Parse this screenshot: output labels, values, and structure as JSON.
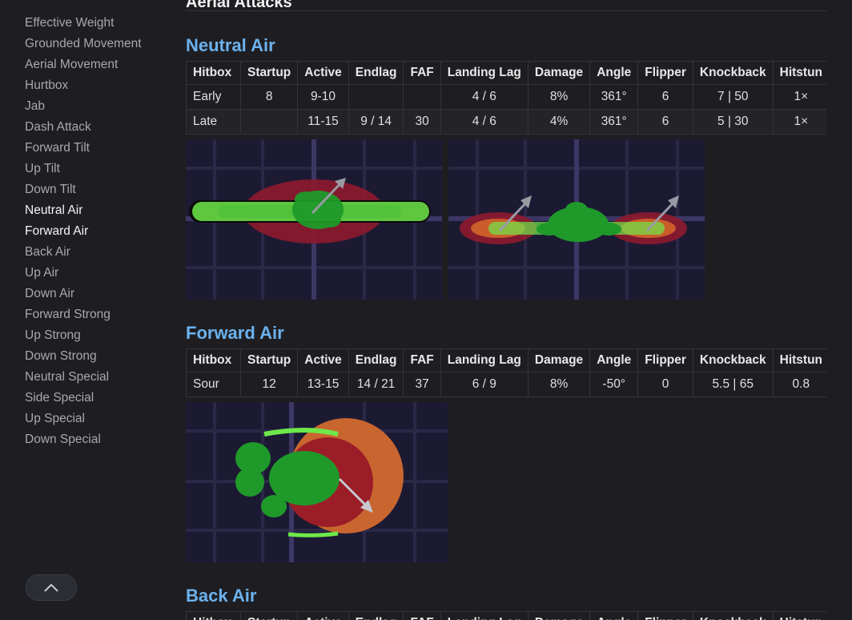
{
  "sidebar": {
    "items": [
      {
        "label": "Effective Weight",
        "active": false
      },
      {
        "label": "Grounded Movement",
        "active": false
      },
      {
        "label": "Aerial Movement",
        "active": false
      },
      {
        "label": "Hurtbox",
        "active": false
      },
      {
        "label": "Jab",
        "active": false
      },
      {
        "label": "Dash Attack",
        "active": false
      },
      {
        "label": "Forward Tilt",
        "active": false
      },
      {
        "label": "Up Tilt",
        "active": false
      },
      {
        "label": "Down Tilt",
        "active": false
      },
      {
        "label": "Neutral Air",
        "active": true
      },
      {
        "label": "Forward Air",
        "active": true
      },
      {
        "label": "Back Air",
        "active": false
      },
      {
        "label": "Up Air",
        "active": false
      },
      {
        "label": "Down Air",
        "active": false
      },
      {
        "label": "Forward Strong",
        "active": false
      },
      {
        "label": "Up Strong",
        "active": false
      },
      {
        "label": "Down Strong",
        "active": false
      },
      {
        "label": "Neutral Special",
        "active": false
      },
      {
        "label": "Side Special",
        "active": false
      },
      {
        "label": "Up Special",
        "active": false
      },
      {
        "label": "Down Special",
        "active": false
      }
    ],
    "back_to_top_icon": "chevron-up-icon"
  },
  "page": {
    "section_header": "Aerial Attacks"
  },
  "columns": [
    "Hitbox",
    "Startup",
    "Active",
    "Endlag",
    "FAF",
    "Landing Lag",
    "Damage",
    "Angle",
    "Flipper",
    "Knockback",
    "Hitstun"
  ],
  "sections": [
    {
      "title": "Neutral Air",
      "rows": [
        [
          "Early",
          "8",
          "9-10",
          "",
          "",
          "4 / 6",
          "8%",
          "361°",
          "6",
          "7 | 50",
          "1×"
        ],
        [
          "Late",
          "",
          "11-15",
          "9 / 14",
          "30",
          "4 / 6",
          "4%",
          "361°",
          "6",
          "5 | 30",
          "1×"
        ]
      ]
    },
    {
      "title": "Forward Air",
      "rows": [
        [
          "Sour",
          "12",
          "13-15",
          "14 / 21",
          "37",
          "6 / 9",
          "8%",
          "-50°",
          "0",
          "5.5 | 65",
          "0.8"
        ]
      ]
    },
    {
      "title": "Back Air",
      "rows": []
    }
  ],
  "colors": {
    "background": "#1e1e22",
    "section_title": "#6cb2ee",
    "hitbox_red": "#8e1a2c",
    "hitbox_green": "#6ee84a",
    "stage_grid": "#1c1a33"
  }
}
